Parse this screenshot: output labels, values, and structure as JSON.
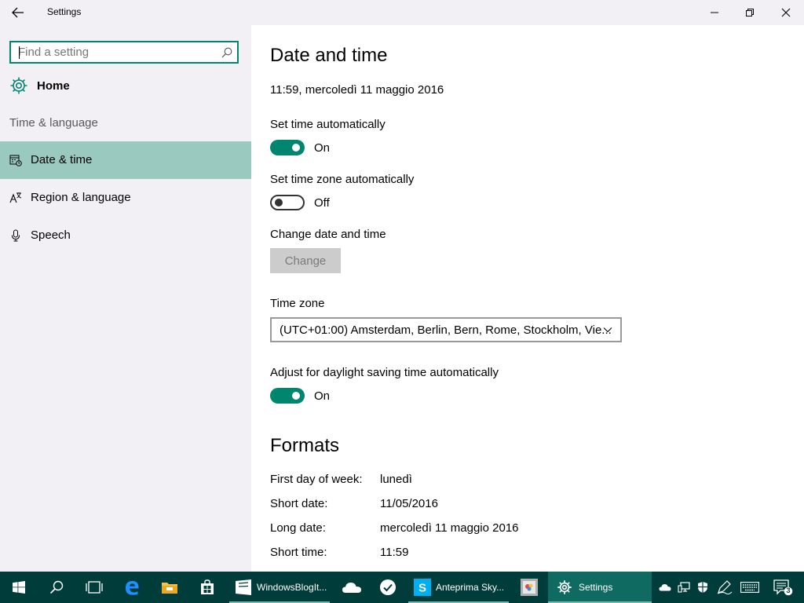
{
  "window": {
    "title": "Settings"
  },
  "sidebar": {
    "search_placeholder": "Find a setting",
    "home_label": "Home",
    "section_label": "Time & language",
    "items": [
      {
        "label": "Date & time",
        "icon": "calendar-clock-icon",
        "active": true
      },
      {
        "label": "Region & language",
        "icon": "region-language-icon",
        "active": false
      },
      {
        "label": "Speech",
        "icon": "microphone-icon",
        "active": false
      }
    ]
  },
  "main": {
    "title": "Date and time",
    "current_datetime": "11:59, mercoledì 11 maggio 2016",
    "set_time_auto": {
      "label": "Set time automatically",
      "state": "On"
    },
    "set_timezone_auto": {
      "label": "Set time zone automatically",
      "state": "Off"
    },
    "change_date": {
      "label": "Change date and time",
      "button": "Change"
    },
    "time_zone": {
      "label": "Time zone",
      "value": "(UTC+01:00) Amsterdam, Berlin, Bern, Rome, Stockholm, Vie..."
    },
    "dst": {
      "label": "Adjust for daylight saving time automatically",
      "state": "On"
    },
    "formats": {
      "title": "Formats",
      "rows": [
        {
          "key": "First day of week:",
          "value": "lunedì"
        },
        {
          "key": "Short date:",
          "value": "11/05/2016"
        },
        {
          "key": "Long date:",
          "value": "mercoledì 11 maggio 2016"
        },
        {
          "key": "Short time:",
          "value": "11:59"
        }
      ]
    }
  },
  "taskbar": {
    "apps": [
      {
        "label": "WindowsBlogIt...",
        "icon": "app-window-icon"
      },
      {
        "label": "Anteprima Sky...",
        "icon": "skype-icon"
      },
      {
        "label": "Settings",
        "icon": "gear-icon"
      }
    ],
    "notification_count": "3"
  },
  "colors": {
    "accent": "#00856f",
    "sidebar_bg": "#f2f0f5",
    "active_item": "#99c9bf",
    "taskbar": "#003c3a"
  }
}
